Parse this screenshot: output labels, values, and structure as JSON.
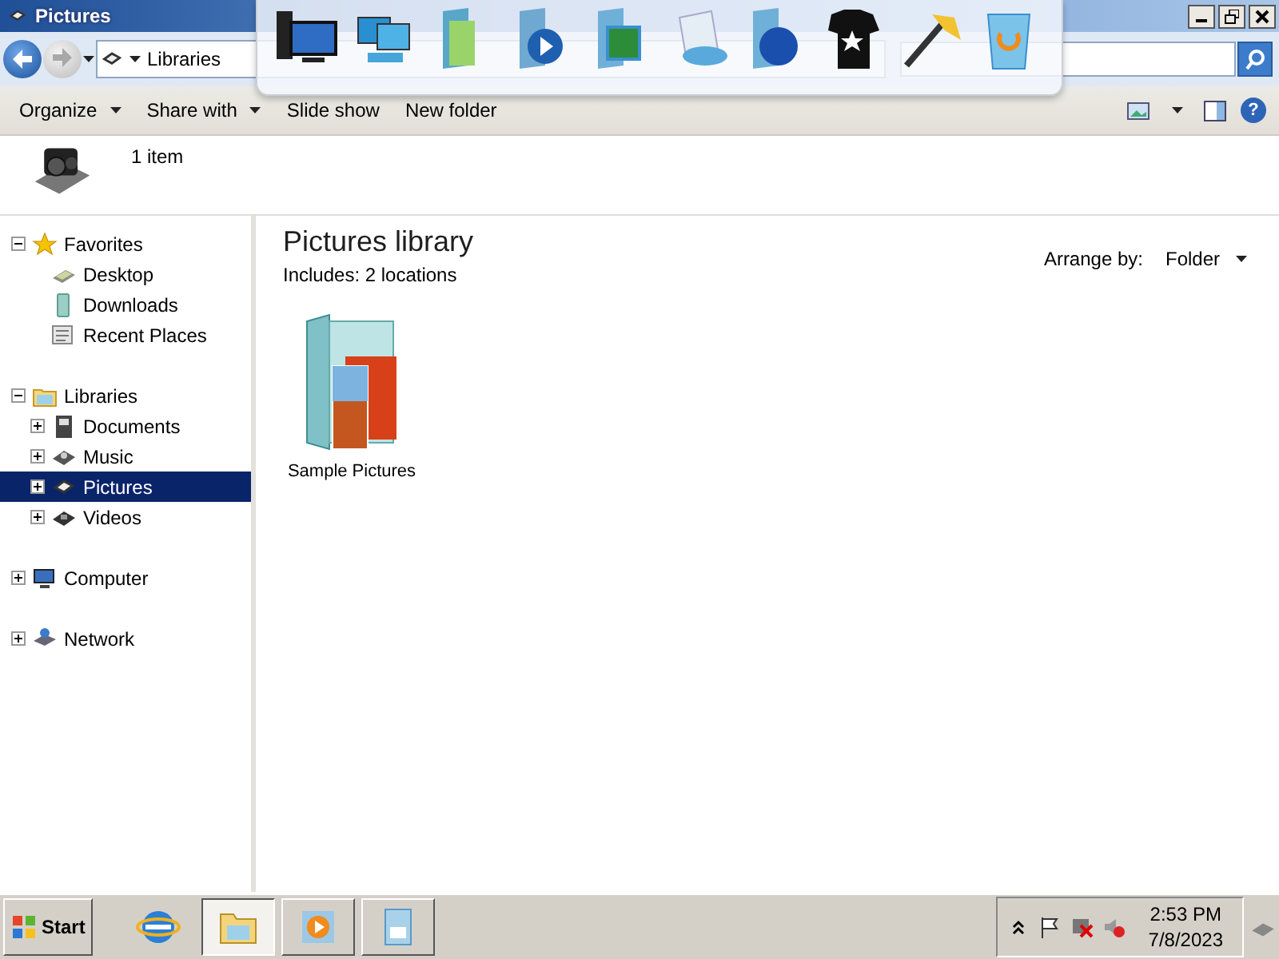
{
  "window": {
    "title": "Pictures"
  },
  "address": {
    "segments": [
      "Libraries"
    ]
  },
  "dock": {
    "icons": [
      {
        "kind": "computer"
      },
      {
        "kind": "monitors"
      },
      {
        "kind": "book"
      },
      {
        "kind": "media"
      },
      {
        "kind": "picture"
      },
      {
        "kind": "glass"
      },
      {
        "kind": "globe"
      },
      {
        "kind": "shirt"
      },
      {
        "kind": "tools"
      },
      {
        "kind": "bin"
      }
    ]
  },
  "toolbar": {
    "buttons": [
      {
        "label": "Organize",
        "kind": "menu"
      },
      {
        "label": "Share with",
        "kind": "menu"
      },
      {
        "label": "Slide show",
        "kind": "plain"
      },
      {
        "label": "New folder",
        "kind": "plain"
      }
    ]
  },
  "help": {
    "label": "?"
  },
  "details": {
    "count": "1 item"
  },
  "nav": [
    {
      "label": "Favorites",
      "kind": "star",
      "expanded": true,
      "selected": false,
      "children": [
        {
          "label": "Desktop",
          "kind": "desktop",
          "selected": false
        },
        {
          "label": "Downloads",
          "kind": "download",
          "selected": false
        },
        {
          "label": "Recent Places",
          "kind": "recent",
          "selected": false
        }
      ]
    },
    {
      "label": "Libraries",
      "kind": "library",
      "expanded": true,
      "selected": false,
      "children": [
        {
          "label": "Documents",
          "kind": "document",
          "expanded": false,
          "selected": false
        },
        {
          "label": "Music",
          "kind": "music",
          "expanded": false,
          "selected": false
        },
        {
          "label": "Pictures",
          "kind": "picture",
          "expanded": false,
          "selected": true
        },
        {
          "label": "Videos",
          "kind": "video",
          "expanded": false,
          "selected": false
        }
      ]
    },
    {
      "label": "Computer",
      "kind": "computer",
      "expanded": false,
      "selected": false
    },
    {
      "label": "Network",
      "kind": "network",
      "expanded": false,
      "selected": false
    }
  ],
  "content": {
    "title": "Pictures library",
    "subtitle": "Includes:  2 locations",
    "arrange_label": "Arrange by:",
    "arrange_value": "Folder",
    "items": [
      {
        "label": "Sample Pictures"
      }
    ]
  },
  "taskbar": {
    "start": "Start",
    "apps": [
      {
        "kind": "browser",
        "selected": false
      },
      {
        "kind": "explorer",
        "selected": true
      },
      {
        "kind": "media",
        "selected": false
      },
      {
        "kind": "document",
        "selected": false
      }
    ],
    "time": "2:53 PM",
    "date": "7/8/2023"
  }
}
